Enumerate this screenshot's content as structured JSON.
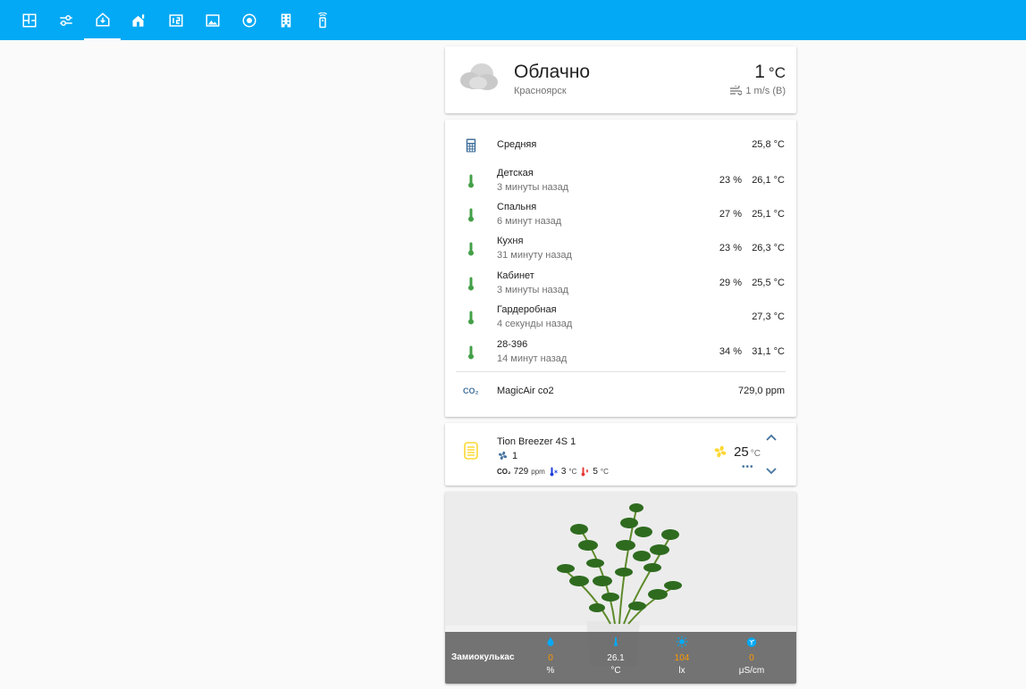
{
  "colors": {
    "header": "#03a9f4",
    "thermo": "#43a047",
    "warn": "#ff9800",
    "accent": "#03a9f4",
    "fan": "#fdd835"
  },
  "tabs": [
    {
      "icon": "floorplan-icon"
    },
    {
      "icon": "tune-icon"
    },
    {
      "icon": "home-icon",
      "active": true
    },
    {
      "icon": "home-import-icon"
    },
    {
      "icon": "counter-icon"
    },
    {
      "icon": "image-area-icon"
    },
    {
      "icon": "robot-vacuum-icon"
    },
    {
      "icon": "office-building-icon"
    },
    {
      "icon": "remote-icon"
    }
  ],
  "weather": {
    "condition": "Облачно",
    "city": "Красноярск",
    "temperature": "1",
    "unit": "°C",
    "wind": "1 m/s (В)"
  },
  "sensors": {
    "average": {
      "name": "Средняя",
      "value": "25,8 °C"
    },
    "rooms": [
      {
        "name": "Детская",
        "updated": "3 минуты назад",
        "humidity": "23 %",
        "temp": "26,1 °C"
      },
      {
        "name": "Спальня",
        "updated": "6 минут назад",
        "humidity": "27 %",
        "temp": "25,1 °C"
      },
      {
        "name": "Кухня",
        "updated": "31 минуту назад",
        "humidity": "23 %",
        "temp": "26,3 °C"
      },
      {
        "name": "Кабинет",
        "updated": "3 минуты назад",
        "humidity": "29 %",
        "temp": "25,5 °C"
      },
      {
        "name": "Гардеробная",
        "updated": "4 секунды назад",
        "humidity": "",
        "temp": "27,3 °C"
      },
      {
        "name": "28-396",
        "updated": "14 минут назад",
        "humidity": "34 %",
        "temp": "31,1 °C"
      }
    ],
    "co2": {
      "icon_text": "CO₂",
      "name": "MagicAir co2",
      "value": "729,0 ppm"
    }
  },
  "breezer": {
    "name": "Tion Breezer 4S 1",
    "speed": "1",
    "co2_label": "CO₂",
    "co2_value": "729",
    "co2_unit": "ppm",
    "temp_in": "3",
    "temp_in_unit": "°C",
    "temp_out": "5",
    "temp_out_unit": "°C",
    "target": "25",
    "target_unit": "°C",
    "more": "•••"
  },
  "plant": {
    "name": "Замиокулькас",
    "readings": [
      {
        "icon": "water-icon",
        "value": "0",
        "unit": "%",
        "color": "#ff9800"
      },
      {
        "icon": "thermometer-icon",
        "value": "26.1",
        "unit": "°C",
        "color": "#ffffff"
      },
      {
        "icon": "sun-icon",
        "value": "104",
        "unit": "lx",
        "color": "#ff9800"
      },
      {
        "icon": "fertilizer-icon",
        "value": "0",
        "unit": "μS/cm",
        "color": "#ff9800"
      }
    ]
  }
}
